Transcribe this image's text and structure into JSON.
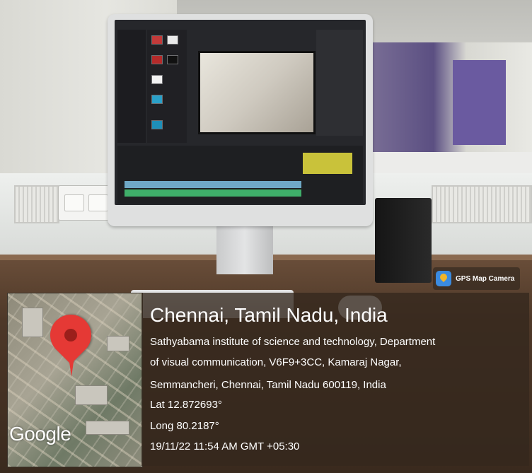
{
  "watermark": {
    "app_name": "GPS Map Camera",
    "app_icon": "gps-map-camera-icon"
  },
  "map": {
    "provider_label": "Google",
    "pin_icon": "map-pin-icon",
    "pin_color": "#e53935"
  },
  "location": {
    "title": "Chennai, Tamil Nadu, India",
    "address_lines": [
      "Sathyabama institute of science and technology, Department",
      "of visual communication, V6F9+3CC, Kamaraj Nagar,",
      "Semmancheri, Chennai, Tamil Nadu 600119, India"
    ],
    "latitude": "Lat 12.872693°",
    "longitude": "Long 80.2187°",
    "timestamp": "19/11/22 11:54 AM GMT +05:30"
  }
}
